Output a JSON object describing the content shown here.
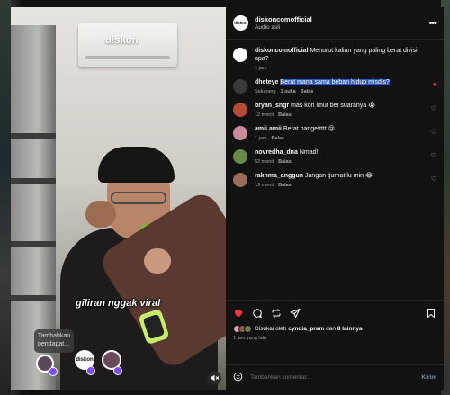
{
  "media": {
    "watermark": "diskon",
    "caption": "giliran nggak viral",
    "comment_prompt": "Tambahkan pendapat..."
  },
  "post": {
    "username": "diskoncomofficial",
    "audio": "Audio asli",
    "avatar_text": "diskon"
  },
  "comments": [
    {
      "user": "diskoncomofficial",
      "text": "Menurut kalian yang paling berat divisi apa?",
      "time": "1 jam",
      "likes": "",
      "reply": "",
      "liked": false,
      "highlight": false,
      "avatar_color": "#ffffff"
    },
    {
      "user": "dheteye",
      "text": "Berat mana sama beban hidup misdis?",
      "time": "Sekarang",
      "likes": "1 suka",
      "reply": "Balas",
      "liked": true,
      "highlight": true,
      "avatar_color": "#3a3a3a"
    },
    {
      "user": "bryan_sngr",
      "text": "mas kon imut bet suaranya 😭",
      "time": "12 menit",
      "likes": "",
      "reply": "Balas",
      "liked": false,
      "highlight": false,
      "avatar_color": "#b84a3a"
    },
    {
      "user": "amii.amii",
      "text": "Berat bangettttt 😢",
      "time": "1 jam",
      "likes": "",
      "reply": "Balas",
      "liked": false,
      "highlight": false,
      "avatar_color": "#c98a9a"
    },
    {
      "user": "novredha_dna",
      "text": "Nmad!",
      "time": "52 menit",
      "likes": "",
      "reply": "Balas",
      "liked": false,
      "highlight": false,
      "avatar_color": "#6a8a4a"
    },
    {
      "user": "rakhma_anggun",
      "text": "Jangan tjurhat lu min 😂",
      "time": "19 menit",
      "likes": "",
      "reply": "Balas",
      "liked": false,
      "highlight": false,
      "avatar_color": "#9a6a5a"
    }
  ],
  "likes_line": {
    "prefix": "Disukai oleh",
    "user": "cyndia_pram",
    "middle": "dan",
    "others": "8 lainnya"
  },
  "posted": "1 jam yang lalu",
  "composer": {
    "placeholder": "Tambahkan komentar...",
    "post_label": "Kirim"
  },
  "colors": {
    "liked_heart": "#ff3040",
    "highlight": "#2b57c7",
    "mic": "#a6e34a"
  }
}
